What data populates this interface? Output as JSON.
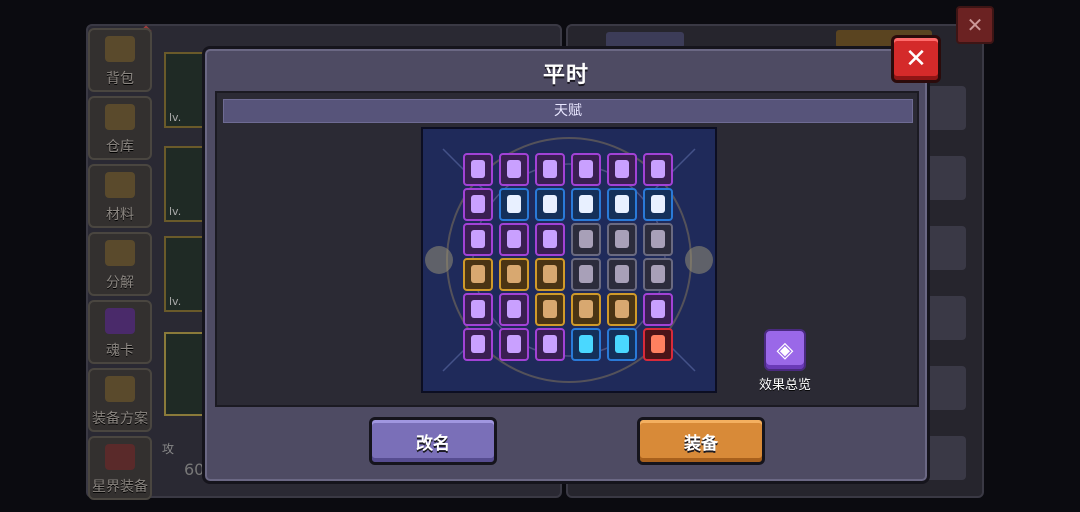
{
  "background": {
    "sidebar": [
      "背包",
      "仓库",
      "材料",
      "分解",
      "魂卡",
      "装备方案",
      "星界装备"
    ],
    "slot_level_prefix": "lv.",
    "attack_label": "攻",
    "attack_value": "60"
  },
  "modal": {
    "title": "平时",
    "section_title": "天赋",
    "close_symbol": "✕",
    "effect_overview_label": "效果总览",
    "rename_button": "改名",
    "equip_button": "装备"
  },
  "talent_grid": {
    "rows": [
      [
        "purple",
        "purple",
        "purple",
        "purple",
        "purple",
        "purple"
      ],
      [
        "purple",
        "blue",
        "blue",
        "blue",
        "blue",
        "blue"
      ],
      [
        "purple",
        "purple",
        "purple",
        "gray",
        "gray",
        "gray"
      ],
      [
        "gold",
        "gold",
        "gold",
        "gray",
        "gray",
        "gray"
      ],
      [
        "purple",
        "purple",
        "gold",
        "gold",
        "gold",
        "purple"
      ],
      [
        "purple",
        "purple",
        "purple",
        "blue",
        "blue",
        "red"
      ]
    ]
  },
  "colors": {
    "modal_bg": "#4e4b63",
    "close_red": "#d42a2a",
    "rename_purple": "#7a6fb8",
    "equip_orange": "#d88a38"
  },
  "icons": {
    "close": "close-icon",
    "effect": "effect-overview-icon"
  }
}
